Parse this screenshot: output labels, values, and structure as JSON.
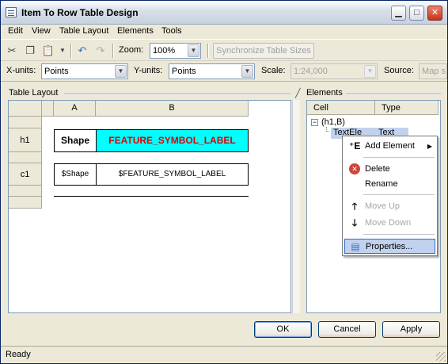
{
  "window": {
    "title": "Item To Row Table Design"
  },
  "menu": [
    "Edit",
    "View",
    "Table Layout",
    "Elements",
    "Tools"
  ],
  "toolbar": {
    "zoom_label": "Zoom:",
    "zoom_value": "100%",
    "sync_label": "Synchronize Table Sizes"
  },
  "units": {
    "x_label": "X-units:",
    "x_value": "Points",
    "y_label": "Y-units:",
    "y_value": "Points",
    "scale_label": "Scale:",
    "scale_value": "1:24,000",
    "source_label": "Source:",
    "source_value": "Map s"
  },
  "table_layout": {
    "header": "Table Layout",
    "columns": [
      "A",
      "B"
    ],
    "rows": [
      "h1",
      "c1"
    ],
    "cells": {
      "h1_a": "Shape",
      "h1_b": "FEATURE_SYMBOL_LABEL",
      "c1_a": "$Shape",
      "c1_b": "$FEATURE_SYMBOL_LABEL"
    },
    "highlight_color": "#00ffff",
    "label_color": "#e00000"
  },
  "elements": {
    "header": "Elements",
    "col_cell": "Cell",
    "col_type": "Type",
    "tree_root": "(h1,B)",
    "tree_child_cell": "TextEle",
    "tree_child_type": "Text"
  },
  "context_menu": {
    "add_element": "Add Element",
    "delete": "Delete",
    "rename": "Rename",
    "move_up": "Move Up",
    "move_down": "Move Down",
    "properties": "Properties..."
  },
  "buttons": {
    "ok": "OK",
    "cancel": "Cancel",
    "apply": "Apply"
  },
  "status": "Ready"
}
